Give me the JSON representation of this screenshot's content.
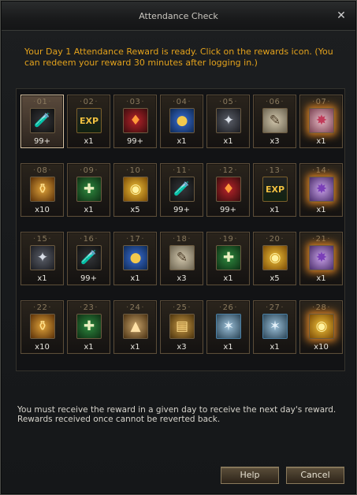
{
  "window": {
    "title": "Attendance Check",
    "message": "Your Day 1 Attendance Reward is ready. Click on the rewards icon. (You can redeem your reward 30 minutes after logging in.)",
    "note_line1": "You must receive the reward in a given day to receive the next day's reward.",
    "note_line2": "Rewards received once cannot be reverted back.",
    "help_label": "Help",
    "cancel_label": "Cancel",
    "close_glyph": "✕"
  },
  "rewards": [
    {
      "day": "01",
      "qty": "99+",
      "icon": "potion",
      "glyph": "🧪",
      "selected": true
    },
    {
      "day": "02",
      "qty": "x1",
      "icon": "exp",
      "glyph": "EXP"
    },
    {
      "day": "03",
      "qty": "99+",
      "icon": "jewel",
      "glyph": "♦"
    },
    {
      "day": "04",
      "qty": "x1",
      "icon": "pouch",
      "glyph": "●"
    },
    {
      "day": "05",
      "qty": "x1",
      "icon": "crystal",
      "glyph": "✦"
    },
    {
      "day": "06",
      "qty": "x3",
      "icon": "scroll",
      "glyph": "✎"
    },
    {
      "day": "07",
      "qty": "x1",
      "icon": "rune",
      "glyph": "✸",
      "glow": true
    },
    {
      "day": "08",
      "qty": "x10",
      "icon": "flask",
      "glyph": "⚱"
    },
    {
      "day": "09",
      "qty": "x1",
      "icon": "bag",
      "glyph": "✚"
    },
    {
      "day": "10",
      "qty": "x5",
      "icon": "coin",
      "glyph": "◉"
    },
    {
      "day": "11",
      "qty": "99+",
      "icon": "potion",
      "glyph": "🧪"
    },
    {
      "day": "12",
      "qty": "99+",
      "icon": "jewel",
      "glyph": "♦"
    },
    {
      "day": "13",
      "qty": "x1",
      "icon": "exp",
      "glyph": "EXP"
    },
    {
      "day": "14",
      "qty": "x1",
      "icon": "rune2",
      "glyph": "✸",
      "glow": true
    },
    {
      "day": "15",
      "qty": "x1",
      "icon": "crystal",
      "glyph": "✦"
    },
    {
      "day": "16",
      "qty": "99+",
      "icon": "potion",
      "glyph": "🧪"
    },
    {
      "day": "17",
      "qty": "x1",
      "icon": "pouch",
      "glyph": "●"
    },
    {
      "day": "18",
      "qty": "x3",
      "icon": "scroll",
      "glyph": "✎"
    },
    {
      "day": "19",
      "qty": "x1",
      "icon": "bag",
      "glyph": "✚"
    },
    {
      "day": "20",
      "qty": "x5",
      "icon": "coin",
      "glyph": "◉"
    },
    {
      "day": "21",
      "qty": "x1",
      "icon": "rune2",
      "glyph": "✸",
      "glow": true
    },
    {
      "day": "22",
      "qty": "x10",
      "icon": "flask",
      "glyph": "⚱"
    },
    {
      "day": "23",
      "qty": "x1",
      "icon": "bag",
      "glyph": "✚"
    },
    {
      "day": "24",
      "qty": "x1",
      "icon": "ore",
      "glyph": "▲"
    },
    {
      "day": "25",
      "qty": "x3",
      "icon": "book",
      "glyph": "▤"
    },
    {
      "day": "26",
      "qty": "x1",
      "icon": "stone",
      "glyph": "✶"
    },
    {
      "day": "27",
      "qty": "x1",
      "icon": "stone",
      "glyph": "✶"
    },
    {
      "day": "28",
      "qty": "x10",
      "icon": "coin",
      "glyph": "◉",
      "glow": true
    }
  ]
}
